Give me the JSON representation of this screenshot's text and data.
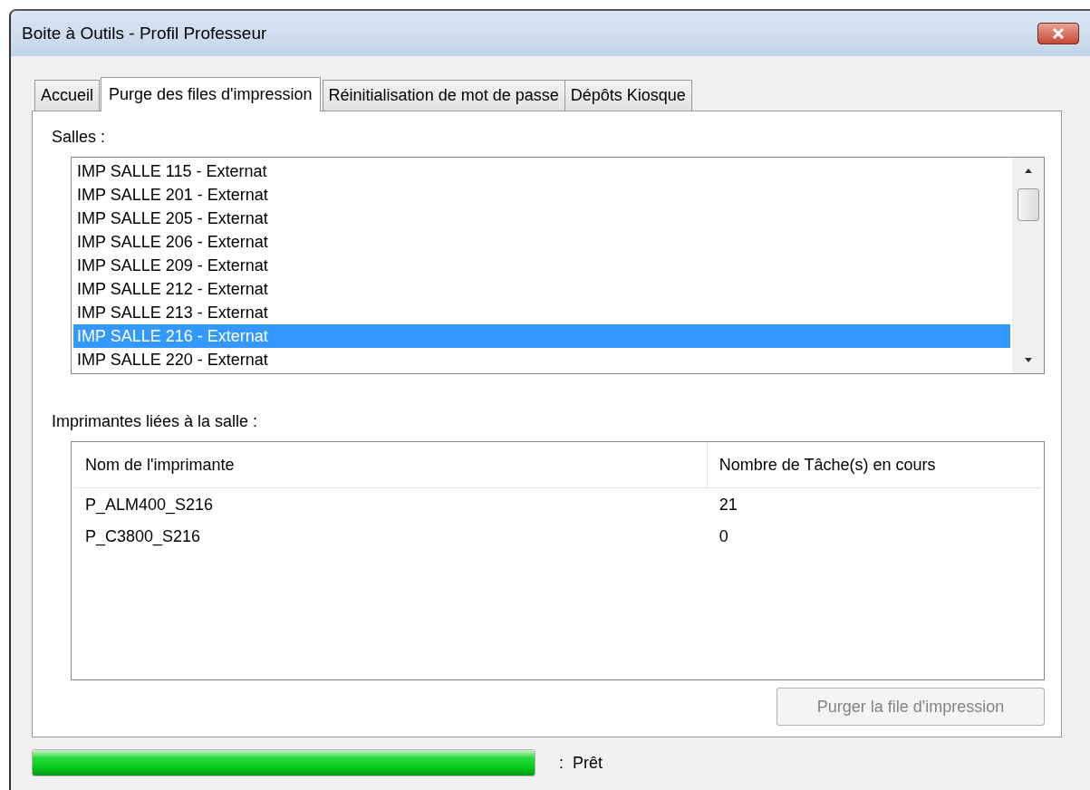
{
  "window": {
    "title": "Boite à Outils - Profil Professeur"
  },
  "tabs": [
    {
      "label": "Accueil",
      "selected": false
    },
    {
      "label": "Purge des files d'impression",
      "selected": true
    },
    {
      "label": "Réinitialisation de mot de passe",
      "selected": false
    },
    {
      "label": "Dépôts Kiosque",
      "selected": false
    }
  ],
  "rooms": {
    "label": "Salles :",
    "items": [
      {
        "text": "IMP SALLE 115 - Externat",
        "selected": false
      },
      {
        "text": "IMP SALLE 201 - Externat",
        "selected": false
      },
      {
        "text": "IMP SALLE 205 - Externat",
        "selected": false
      },
      {
        "text": "IMP SALLE 206 - Externat",
        "selected": false
      },
      {
        "text": "IMP SALLE 209 - Externat",
        "selected": false
      },
      {
        "text": "IMP SALLE 212 - Externat",
        "selected": false
      },
      {
        "text": "IMP SALLE 213 - Externat",
        "selected": false
      },
      {
        "text": "IMP SALLE 216 - Externat",
        "selected": true
      },
      {
        "text": "IMP SALLE 220 - Externat",
        "selected": false
      }
    ]
  },
  "printers": {
    "label": "Imprimantes liées à la salle :",
    "columns": [
      "Nom de l'imprimante",
      "Nombre de Tâche(s) en cours"
    ],
    "rows": [
      [
        "P_ALM400_S216",
        "21"
      ],
      [
        "P_C3800_S216",
        "0"
      ]
    ]
  },
  "purge_button": {
    "label": "Purger la file d'impression",
    "disabled": true
  },
  "status": {
    "level": 1,
    "text": ":  Prêt"
  }
}
